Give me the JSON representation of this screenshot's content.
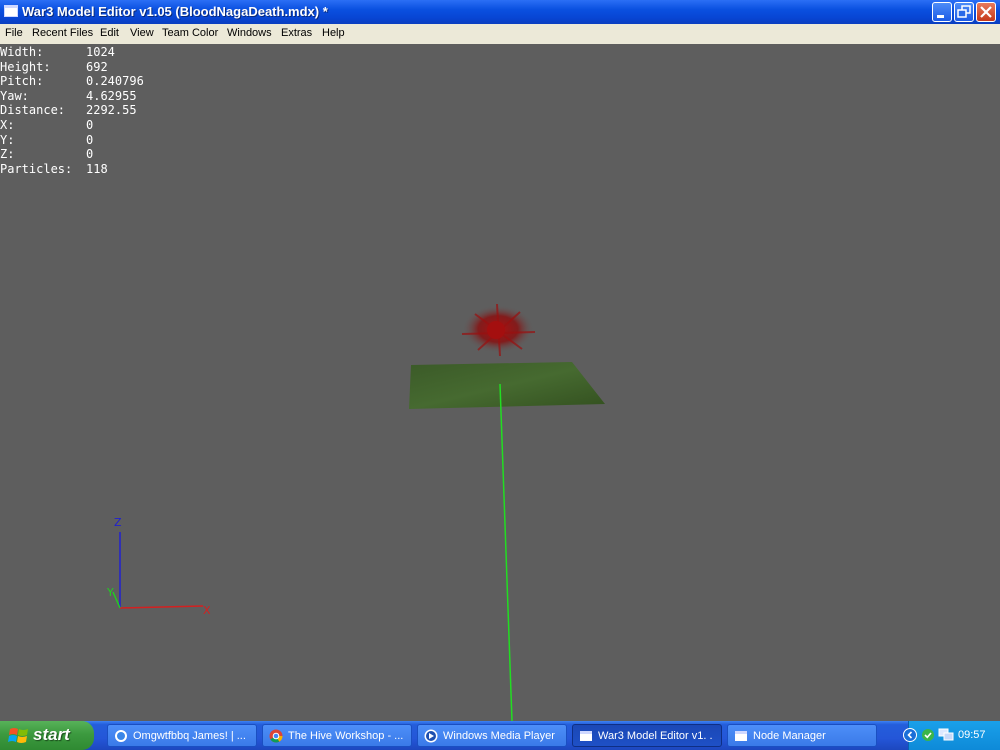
{
  "window": {
    "title": "War3 Model Editor v1.05 (BloodNagaDeath.mdx) *",
    "minimize_icon": "minimize-icon",
    "restore_icon": "restore-icon",
    "close_icon": "close-icon"
  },
  "menu": {
    "items": [
      {
        "label": "File"
      },
      {
        "label": "Recent Files"
      },
      {
        "label": "Edit"
      },
      {
        "label": "View"
      },
      {
        "label": "Team Color"
      },
      {
        "label": "Windows"
      },
      {
        "label": "Extras"
      },
      {
        "label": "Help"
      }
    ]
  },
  "stats": [
    {
      "label": "Width:",
      "value": "1024"
    },
    {
      "label": "Height:",
      "value": "692"
    },
    {
      "label": "Pitch:",
      "value": "0.240796"
    },
    {
      "label": "Yaw:",
      "value": "4.62955"
    },
    {
      "label": "Distance:",
      "value": "2292.55"
    },
    {
      "label": "X:",
      "value": "0"
    },
    {
      "label": "Y:",
      "value": "0"
    },
    {
      "label": "Z:",
      "value": "0"
    },
    {
      "label": "Particles:",
      "value": "118"
    }
  ],
  "axes": {
    "x_label": "X",
    "y_label": "Y",
    "z_label": "Z",
    "x_color": "#d42020",
    "y_color": "#22cc22",
    "z_color": "#2020d0"
  },
  "scene": {
    "background_color": "#5e5e5e",
    "plane_color": "#3e5a2a",
    "particle_color": "#a01010"
  },
  "taskbar": {
    "start_label": "start",
    "tasks": [
      {
        "label": "Omgwtfbbq James! | ...",
        "icon": "chat-icon"
      },
      {
        "label": "The Hive Workshop - ...",
        "icon": "chrome-icon"
      },
      {
        "label": "Windows Media Player",
        "icon": "media-player-icon"
      },
      {
        "label": "War3 Model Editor v1. .",
        "icon": "window-icon"
      },
      {
        "label": "Node Manager",
        "icon": "window-icon"
      }
    ],
    "clock": "09:57"
  }
}
